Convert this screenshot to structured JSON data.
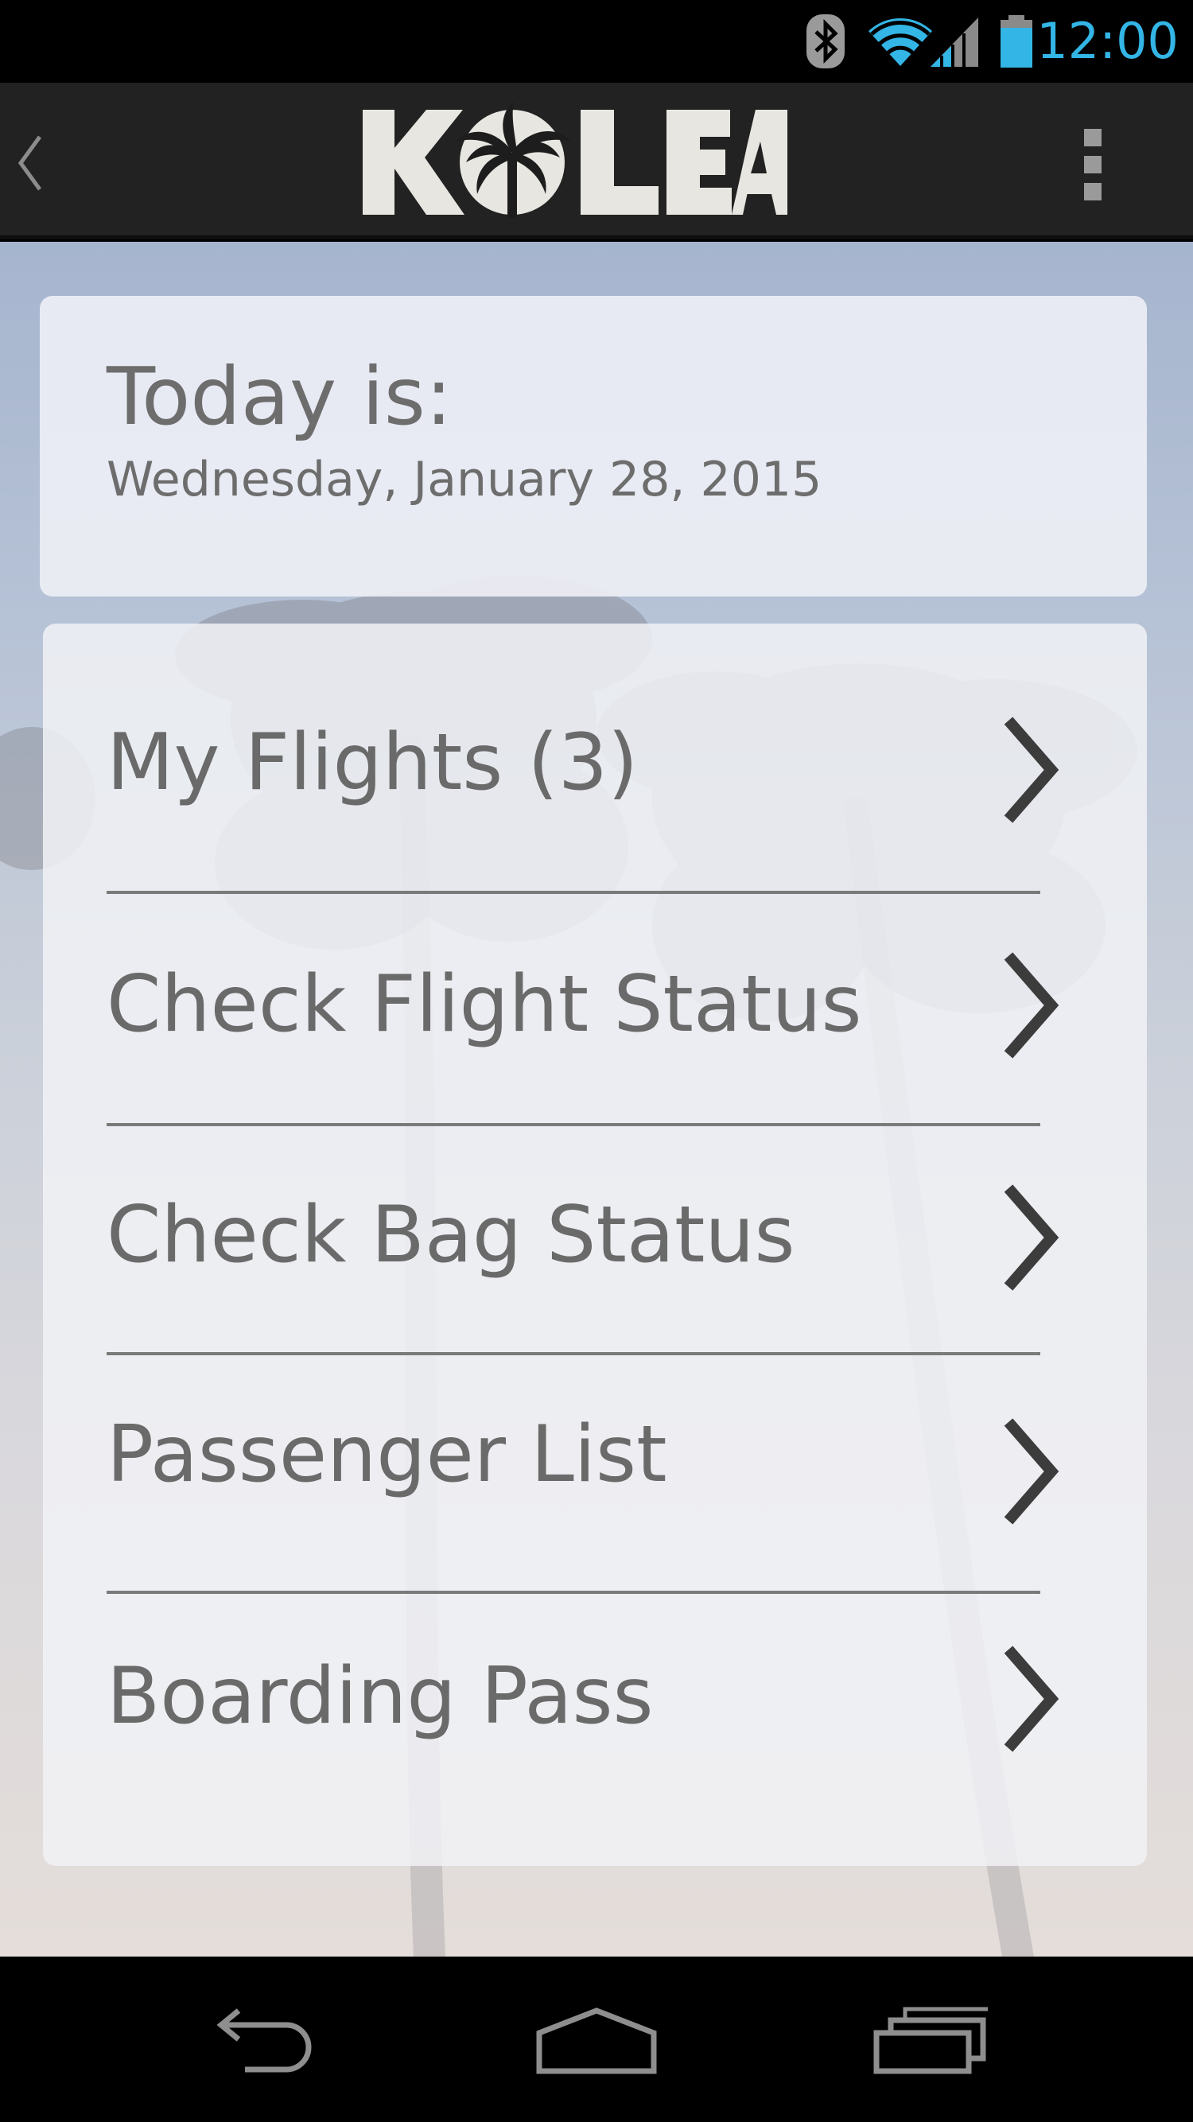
{
  "status_bar": {
    "time": "12:00",
    "icons": [
      "bluetooth-icon",
      "wifi-icon",
      "cell-signal-icon",
      "battery-icon"
    ],
    "accent_color": "#33b5e5"
  },
  "action_bar": {
    "logo_text": "KOLEA",
    "up_icon": "chevron-left-icon",
    "overflow_icon": "overflow-menu-icon"
  },
  "date_card": {
    "label": "Today is:",
    "date": "Wednesday, January 28, 2015"
  },
  "menu": {
    "items": [
      {
        "label": "My Flights (3)"
      },
      {
        "label": "Check Flight Status"
      },
      {
        "label": "Check Bag Status"
      },
      {
        "label": "Passenger List"
      },
      {
        "label": "Boarding Pass"
      }
    ]
  },
  "nav_bar": {
    "icons": [
      "back-icon",
      "home-icon",
      "recents-icon"
    ]
  }
}
